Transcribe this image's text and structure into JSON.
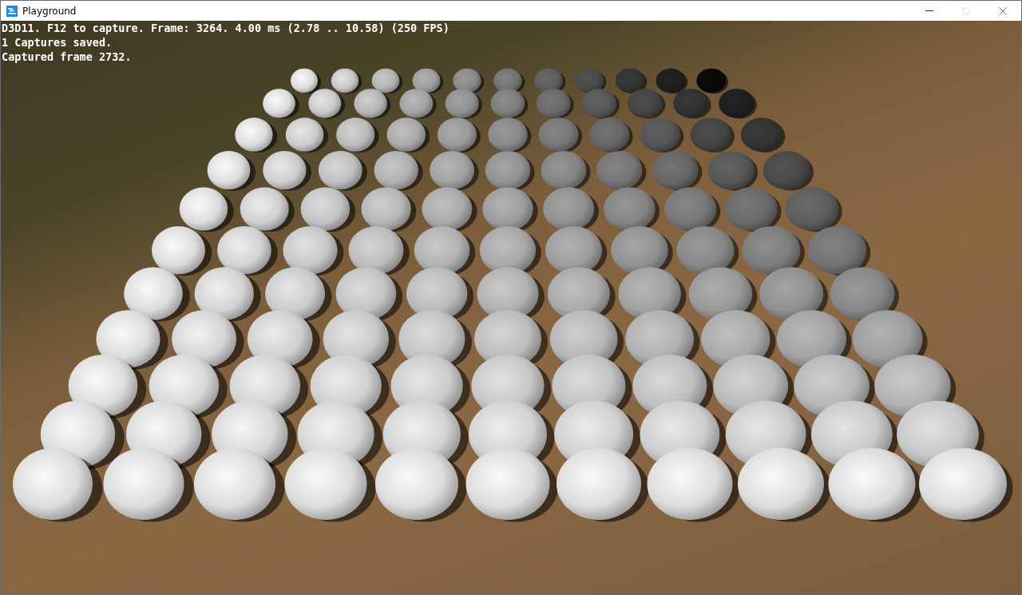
{
  "window": {
    "title": "Playground"
  },
  "overlay_lines": [
    "D3D11. F12 to capture. Frame: 3264. 4.00 ms (2.78 .. 10.58) (250 FPS)",
    "1 Captures saved.",
    "Captured frame 2732."
  ]
}
